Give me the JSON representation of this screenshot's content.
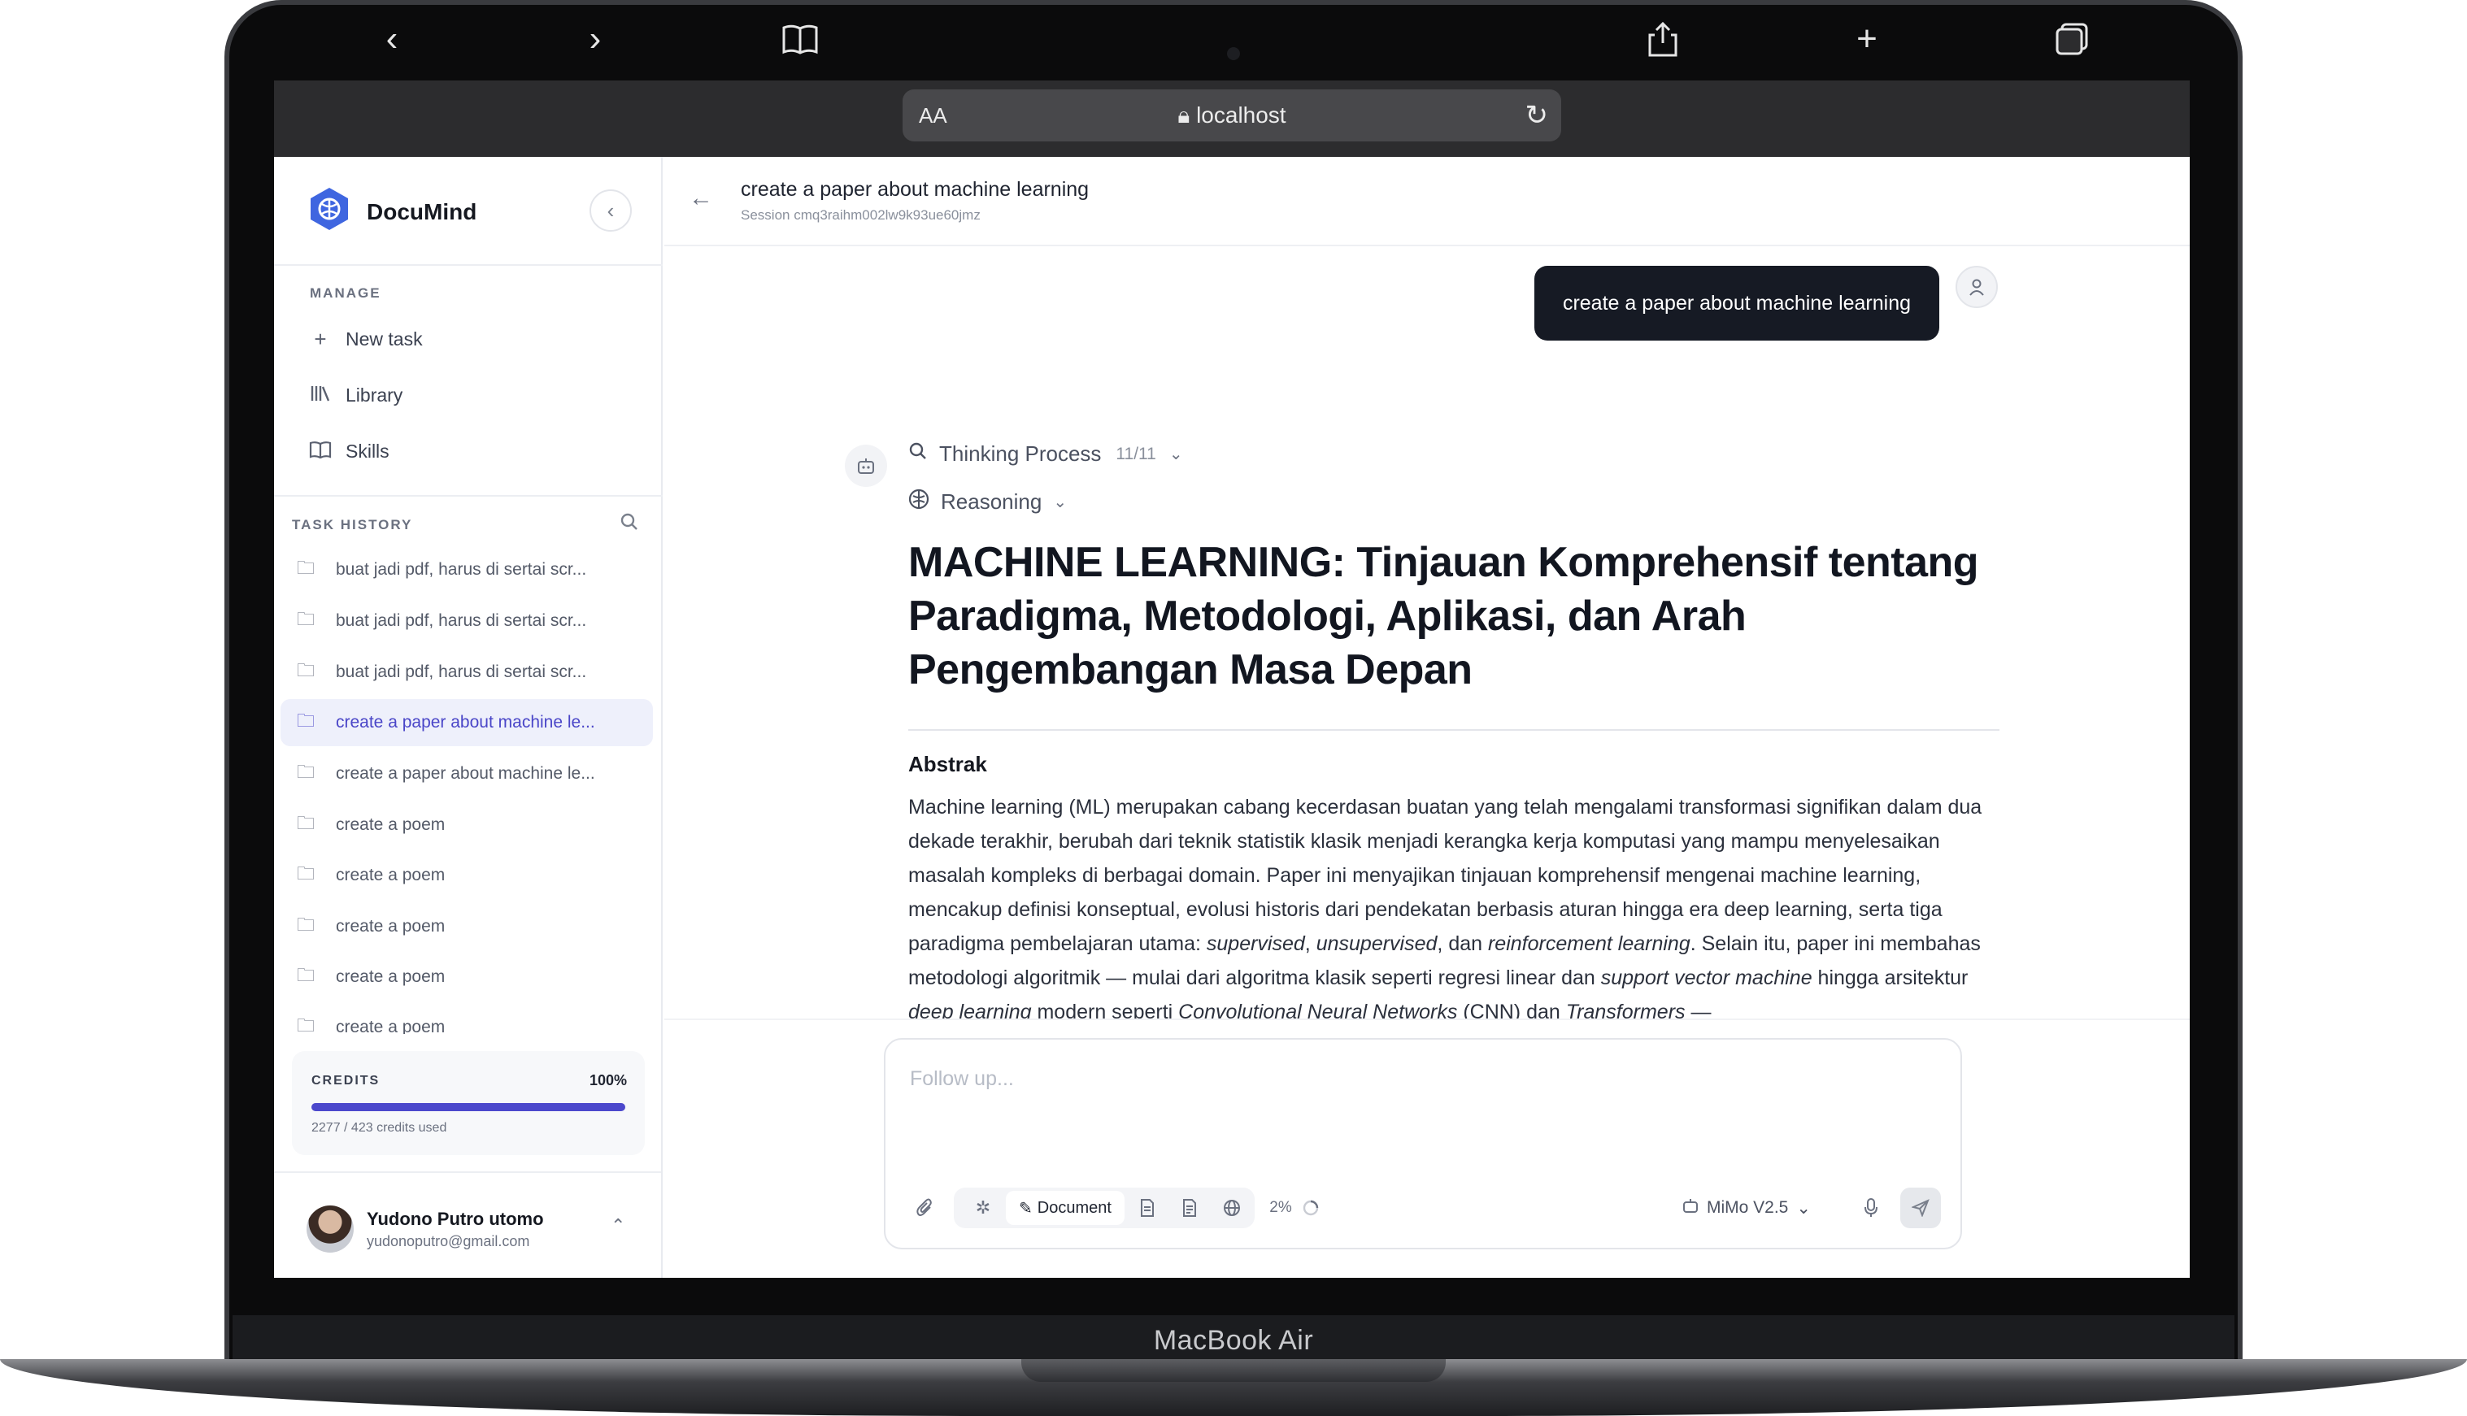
{
  "browser": {
    "aa_label": "AA",
    "url": "localhost"
  },
  "device": {
    "brand": "MacBook Air"
  },
  "sidebar": {
    "app_name": "DocuMind",
    "manage_label": "MANAGE",
    "manage_items": [
      {
        "label": "New task",
        "icon": "plus-icon"
      },
      {
        "label": "Library",
        "icon": "library-icon"
      },
      {
        "label": "Skills",
        "icon": "book-icon"
      }
    ],
    "history_label": "TASK HISTORY",
    "history": [
      {
        "label": "buat jadi pdf, harus di sertai scr..."
      },
      {
        "label": "buat jadi pdf, harus di sertai scr..."
      },
      {
        "label": "buat jadi pdf, harus di sertai scr..."
      },
      {
        "label": "create a paper about machine le...",
        "active": true
      },
      {
        "label": "create a paper about machine le..."
      },
      {
        "label": "create a poem"
      },
      {
        "label": "create a poem"
      },
      {
        "label": "create a poem"
      },
      {
        "label": "create a poem"
      },
      {
        "label": "create a poem"
      }
    ],
    "credits": {
      "label": "CREDITS",
      "percent_label": "100%",
      "fill_fraction": 1.0,
      "used": "2277 / 423 credits used"
    },
    "user": {
      "name": "Yudono Putro utomo",
      "email": "yudonoputro@gmail.com"
    }
  },
  "main": {
    "title": "create a paper about machine learning",
    "session": "Session cmq3raihm002lw9k93ue60jmz",
    "user_message": "create a paper about machine learning",
    "thinking": {
      "label": "Thinking Process",
      "count": "11/11"
    },
    "reasoning": {
      "label": "Reasoning"
    },
    "doc_title": "MACHINE LEARNING: Tinjauan Komprehensif tentang Paradigma, Metodologi, Aplikasi, dan Arah Pengembangan Masa Depan",
    "abstract_heading": "Abstrak",
    "abstract_part1": "Machine learning (ML) merupakan cabang kecerdasan buatan yang telah mengalami transformasi signifikan dalam dua dekade terakhir, berubah dari teknik statistik klasik menjadi kerangka kerja komputasi yang mampu menyelesaikan masalah kompleks di berbagai domain. Paper ini menyajikan tinjauan komprehensif mengenai machine learning, mencakup definisi konseptual, evolusi historis dari pendekatan berbasis aturan hingga era deep learning, serta tiga paradigma pembelajaran utama: ",
    "abstract_supervised": "supervised",
    "abstract_unsupervised": "unsupervised",
    "abstract_dan": ", dan ",
    "abstract_reinforcement": "reinforcement learning",
    "abstract_part2": ". Selain itu, paper ini membahas metodologi algoritmik — mulai dari algoritma klasik seperti regresi linear dan ",
    "abstract_svm": "support vector machine",
    "abstract_part3": " hingga arsitektur ",
    "abstract_deep": "deep learning",
    "abstract_part4": " modern seperti ",
    "abstract_cnn": "Convolutional Neural Networks",
    "abstract_part5": " (CNN) dan ",
    "abstract_transformers": "Transformers",
    "abstract_part6": " —",
    "input_placeholder": "Follow up...",
    "document_button": "Document",
    "progress": "2%",
    "model": "MiMo V2.5"
  }
}
